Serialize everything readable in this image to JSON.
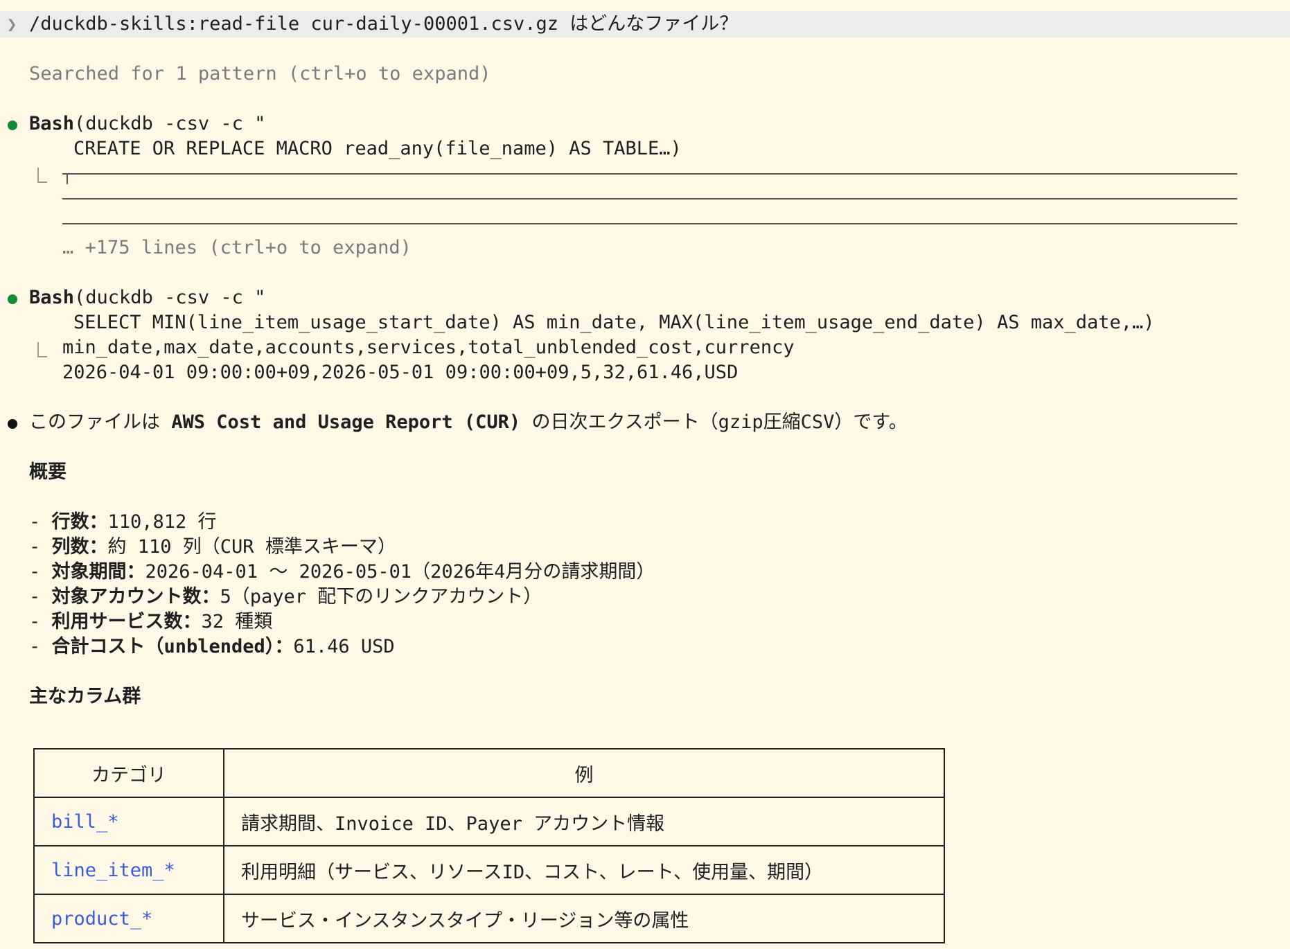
{
  "prompt": {
    "chevron": "❯",
    "text": "/duckdb-skills:read-file cur-daily-00001.csv.gz はどんなファイル？"
  },
  "search_summary": "Searched for 1 pattern (ctrl+o to expand)",
  "bash1": {
    "tool": "Bash",
    "args": "(duckdb -csv -c \"",
    "command": "CREATE OR REPLACE MACRO read_any(file_name) AS TABLE…)",
    "expand": "… +175 lines (ctrl+o to expand)"
  },
  "bash2": {
    "tool": "Bash",
    "args": "(duckdb -csv -c \"",
    "command": "SELECT MIN(line_item_usage_start_date) AS min_date, MAX(line_item_usage_end_date) AS max_date,…)",
    "output_header": "min_date,max_date,accounts,services,total_unblended_cost,currency",
    "output_row": "2026-04-01 09:00:00+09,2026-05-01 09:00:00+09,5,32,61.46,USD"
  },
  "answer": {
    "intro_before": "このファイルは ",
    "intro_bold": "AWS Cost and Usage Report (CUR)",
    "intro_after": " の日次エクスポート（gzip圧縮CSV）です。",
    "overview_heading": "概要",
    "overview_items": [
      {
        "dash": "- ",
        "label": "行数",
        "sep": "：",
        "value": "110,812 行"
      },
      {
        "dash": "- ",
        "label": "列数",
        "sep": "：",
        "value": "約 110 列（CUR 標準スキーマ）"
      },
      {
        "dash": "- ",
        "label": "対象期間",
        "sep": "：",
        "value": "2026-04-01 〜 2026-05-01（2026年4月分の請求期間）"
      },
      {
        "dash": "- ",
        "label": "対象アカウント数",
        "sep": "：",
        "value": "5（payer 配下のリンクアカウント）"
      },
      {
        "dash": "- ",
        "label": "利用サービス数",
        "sep": "：",
        "value": "32 種類"
      },
      {
        "dash": "- ",
        "label": "合計コスト（unblended）",
        "sep": "：",
        "value": "61.46 USD"
      }
    ],
    "columns_heading": "主なカラム群"
  },
  "table": {
    "headers": [
      "カテゴリ",
      "例"
    ],
    "rows": [
      {
        "category": "bill_*",
        "example": "請求期間、Invoice ID、Payer アカウント情報"
      },
      {
        "category": "line_item_*",
        "example": "利用明細（サービス、リソースID、コスト、レート、使用量、期間）"
      },
      {
        "category": "product_*",
        "example": "サービス・インスタンスタイプ・リージョン等の属性"
      }
    ]
  },
  "colors": {
    "background": "#fff8e6",
    "prompt_bar": "#ececec",
    "tool_dot": "#148a36",
    "link": "#3b5bd9"
  }
}
